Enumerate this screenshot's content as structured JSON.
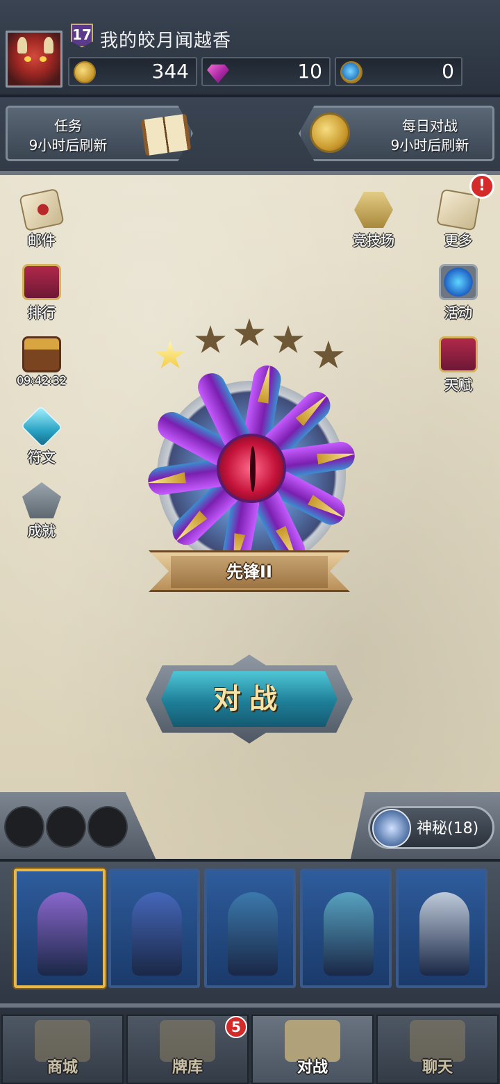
{
  "player": {
    "level": "17",
    "name": "我的皎月闻越香"
  },
  "currencies": {
    "gold": {
      "icon": "gold-coin-icon",
      "value": "344"
    },
    "gems": {
      "icon": "gem-icon",
      "value": "10"
    },
    "tokens": {
      "icon": "blue-token-icon",
      "value": "0"
    }
  },
  "quests": {
    "tasks": {
      "title": "任务",
      "refresh": "9小时后刷新"
    },
    "daily": {
      "title": "每日对战",
      "refresh": "9小时后刷新"
    }
  },
  "left_menu": [
    {
      "label": "邮件",
      "icon": "mail-icon"
    },
    {
      "label": "排行",
      "icon": "ranking-banner-icon"
    },
    {
      "label": "09:42:32",
      "icon": "treasure-chest-icon"
    },
    {
      "label": "符文",
      "icon": "rune-crystal-icon"
    },
    {
      "label": "成就",
      "icon": "achievement-arrow-icon"
    }
  ],
  "right_menu": [
    {
      "label": "竞技场",
      "icon": "arena-swords-icon"
    },
    {
      "label": "更多",
      "icon": "scroll-magnifier-icon",
      "alert": "!"
    },
    {
      "label": "活动",
      "icon": "portal-icon"
    },
    {
      "label": "天赋",
      "icon": "talent-banner-icon"
    }
  ],
  "rank": {
    "name": "先锋II",
    "stars_filled": 1,
    "stars_total": 5
  },
  "battle_button": "对战",
  "mystery": {
    "label": "神秘(18)",
    "icon": "mystery-swirl-icon"
  },
  "card_slots": 3,
  "deck_cards": [
    {
      "name": "whale-card",
      "selected": true,
      "color": "#9a6ad6"
    },
    {
      "name": "sorceress-card",
      "selected": false,
      "color": "#4a6ac0"
    },
    {
      "name": "warrior-woman-card",
      "selected": false,
      "color": "#3e7fb0"
    },
    {
      "name": "mermaid-card",
      "selected": false,
      "color": "#5fb0c8"
    },
    {
      "name": "seagull-card",
      "selected": false,
      "color": "#d8dfe6"
    }
  ],
  "nav": [
    {
      "label": "商城",
      "icon": "shop-icon",
      "active": false
    },
    {
      "label": "牌库",
      "icon": "card-deck-icon",
      "active": false,
      "badge": "5"
    },
    {
      "label": "对战",
      "icon": "battle-crossed-swords-icon",
      "active": true
    },
    {
      "label": "聊天",
      "icon": "chat-fist-icon",
      "active": false
    }
  ]
}
